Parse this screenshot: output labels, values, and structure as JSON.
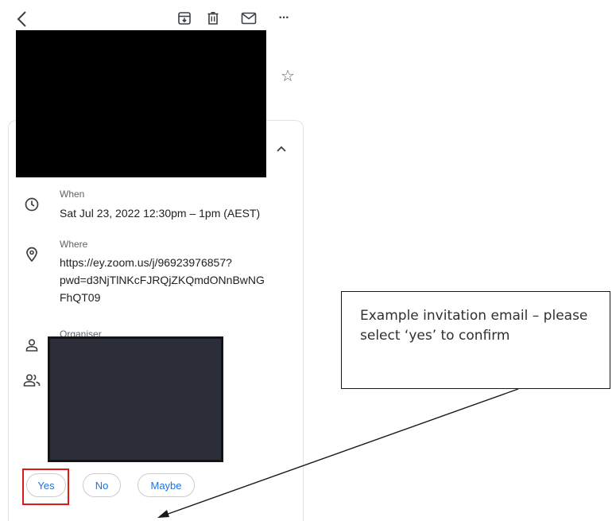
{
  "toolbar": {
    "back_icon": "chevron-left-icon",
    "archive_icon": "archive-icon",
    "delete_icon": "trash-icon",
    "mark_unread_icon": "mail-icon",
    "more_icon": "more-horizontal-icon",
    "star_icon": "star-icon",
    "star_glyph": "☆",
    "more_glyph": "···"
  },
  "event": {
    "collapse_icon": "chevron-up-icon",
    "when": {
      "icon": "clock-icon",
      "label": "When",
      "value": "Sat Jul 23, 2022 12:30pm – 1pm (AEST)"
    },
    "where": {
      "icon": "location-pin-icon",
      "label": "Where",
      "lines": [
        "https://ey.zoom.us/j/96923976857?",
        "pwd=d3NjTlNKcFJRQjZKQmdONnBwNG",
        "FhQT09"
      ]
    },
    "organiser": {
      "icon": "person-icon",
      "label": "Organiser"
    },
    "guests": {
      "icon": "people-icon"
    }
  },
  "rsvp": {
    "yes_label": "Yes",
    "no_label": "No",
    "maybe_label": "Maybe"
  },
  "callout": {
    "text": "Example invitation email – please select ‘yes’ to confirm"
  },
  "colors": {
    "accent": "#1a73e8",
    "highlight": "#e0191b",
    "text": "#202124",
    "muted": "#5f6368"
  }
}
